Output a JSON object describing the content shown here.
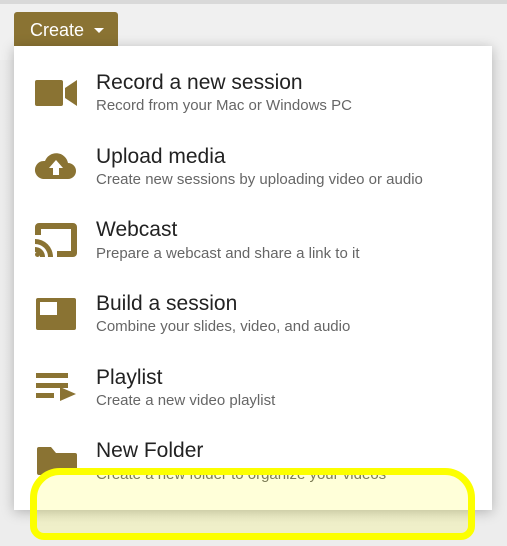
{
  "create_button": {
    "label": "Create"
  },
  "menu": {
    "items": [
      {
        "title": "Record a new session",
        "subtitle": "Record from your Mac or Windows PC",
        "icon": "video-camera-icon",
        "name": "menu-item-record"
      },
      {
        "title": "Upload media",
        "subtitle": "Create new sessions by uploading video or audio",
        "icon": "cloud-upload-icon",
        "name": "menu-item-upload"
      },
      {
        "title": "Webcast",
        "subtitle": "Prepare a webcast and share a link to it",
        "icon": "cast-icon",
        "name": "menu-item-webcast"
      },
      {
        "title": "Build a session",
        "subtitle": "Combine your slides, video, and audio",
        "icon": "slides-icon",
        "name": "menu-item-build"
      },
      {
        "title": "Playlist",
        "subtitle": "Create a new video playlist",
        "icon": "playlist-icon",
        "name": "menu-item-playlist"
      },
      {
        "title": "New Folder",
        "subtitle": "Create a new folder to organize your videos",
        "icon": "folder-icon",
        "name": "menu-item-new-folder"
      }
    ]
  },
  "colors": {
    "accent": "#8a7333",
    "highlight": "#fcff00"
  }
}
